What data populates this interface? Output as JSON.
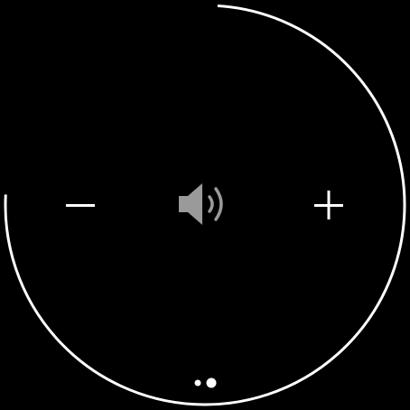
{
  "screen": {
    "title": "",
    "background_color": "#000000"
  },
  "volume": {
    "level_fraction": 0.74,
    "ring_color": "#ffffff",
    "decrease_icon": "minus-icon",
    "increase_icon": "plus-icon",
    "speaker_icon": "speaker-volume-icon",
    "speaker_color": "#9a9a9a",
    "button_color": "#ffffff"
  },
  "pager": {
    "page_count": 2,
    "current_page": 2,
    "active_color": "#ffffff",
    "inactive_color": "#ffffff"
  }
}
